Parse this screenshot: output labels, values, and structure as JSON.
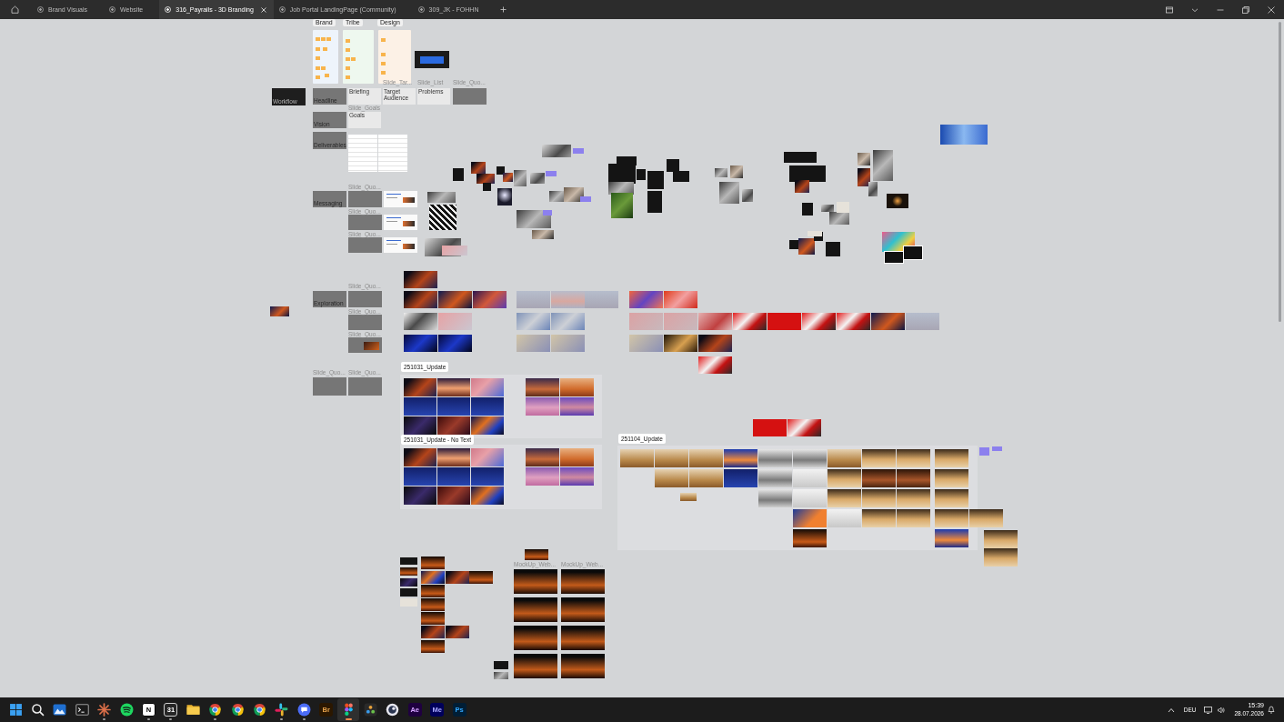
{
  "tab_bar": {
    "tabs": [
      {
        "label": "Brand Visuals",
        "selected": false
      },
      {
        "label": "Website",
        "selected": false
      },
      {
        "label": "316_Payrails - 3D Branding",
        "selected": true
      },
      {
        "label": "Job Portal LandingPage (Community)",
        "selected": false
      },
      {
        "label": "309_JK - FOHHN",
        "selected": false
      }
    ]
  },
  "canvas": {
    "board_tags": [
      "Brand",
      "Tribe",
      "Design"
    ],
    "slide_captions": [
      "Slide_Tar...",
      "Slide_List",
      "Slide_Quo...",
      "Slide_Goals",
      "Slide_Quo...",
      "Slide_Quo...",
      "Slide_Quo...",
      "Slide_Quo...",
      "Slide_Quo...",
      "Slide_Quo...",
      "Slide_Quo...",
      "Slide_Quo...",
      "MockUp_Web...",
      "MockUp_Web..."
    ],
    "slide_titles": [
      "Workflow",
      "Headline",
      "Vision",
      "Deliverables",
      "Briefing",
      "Target Audience",
      "Problems",
      "Goals",
      "Messaging",
      "Exploration"
    ],
    "frame_tags": [
      "251031_Update",
      "251031_Update - No Text",
      "251104_Update"
    ]
  },
  "taskbar": {
    "apps": [
      {
        "running": false,
        "selected": false
      },
      {
        "running": false,
        "selected": false
      },
      {
        "running": false,
        "selected": false
      },
      {
        "running": false,
        "selected": false
      },
      {
        "running": true,
        "selected": false
      },
      {
        "running": false,
        "selected": false
      },
      {
        "label": "N",
        "running": true,
        "selected": false
      },
      {
        "label": "31",
        "running": true,
        "selected": false
      },
      {
        "running": false,
        "selected": false
      },
      {
        "running": true,
        "selected": false
      },
      {
        "running": false,
        "selected": false
      },
      {
        "running": false,
        "selected": false
      },
      {
        "running": true,
        "selected": false
      },
      {
        "running": true,
        "selected": false
      },
      {
        "label": "Br",
        "running": false,
        "selected": false
      },
      {
        "running": true,
        "selected": true
      },
      {
        "running": false,
        "selected": false
      },
      {
        "running": false,
        "selected": false
      },
      {
        "label": "Ae",
        "running": false,
        "selected": false
      },
      {
        "label": "Me",
        "running": false,
        "selected": false
      },
      {
        "label": "Ps",
        "running": false,
        "selected": false
      }
    ],
    "language": "DEU",
    "time": "15:39",
    "date": "28.07.2026"
  }
}
